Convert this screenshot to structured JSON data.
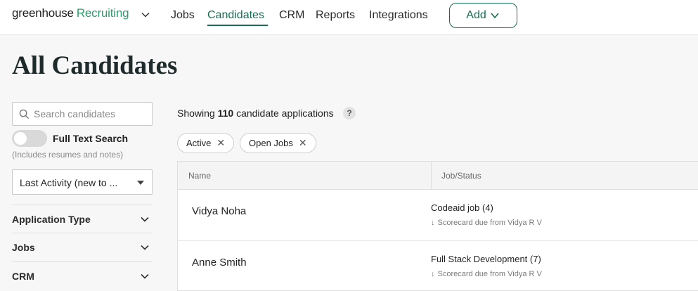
{
  "app": {
    "logo_text": "greenhouse",
    "product": "Recruiting",
    "brand_color": "#176c52",
    "logo_caret_icon": "chevron-down-icon"
  },
  "nav": {
    "items": [
      {
        "label": "Jobs",
        "active": false
      },
      {
        "label": "Candidates",
        "active": true
      },
      {
        "label": "CRM",
        "active": false
      },
      {
        "label": "Reports",
        "active": false
      },
      {
        "label": "Integrations",
        "active": false
      }
    ],
    "add_label": "Add"
  },
  "page": {
    "title": "All Candidates"
  },
  "sidebar": {
    "search_placeholder": "Search candidates",
    "full_text_search_label": "Full Text Search",
    "full_text_search_enabled": false,
    "full_text_search_note": "(Includes resumes and notes)",
    "sort_value": "Last Activity (new to ...",
    "filters": [
      {
        "label": "Application Type"
      },
      {
        "label": "Jobs"
      },
      {
        "label": "CRM"
      }
    ]
  },
  "results": {
    "showing_prefix": "Showing",
    "count": "110",
    "showing_suffix": "candidate applications",
    "help_symbol": "?",
    "active_filters": [
      {
        "label": "Active"
      },
      {
        "label": "Open Jobs"
      }
    ]
  },
  "table": {
    "columns": [
      "Name",
      "Job/Status"
    ],
    "rows": [
      {
        "name": "Vidya Noha",
        "job": "Codeaid job (4)",
        "status": "Scorecard due from Vidya R V"
      },
      {
        "name": "Anne Smith",
        "job": "Full Stack Development (7)",
        "status": "Scorecard due from Vidya R V"
      }
    ]
  }
}
